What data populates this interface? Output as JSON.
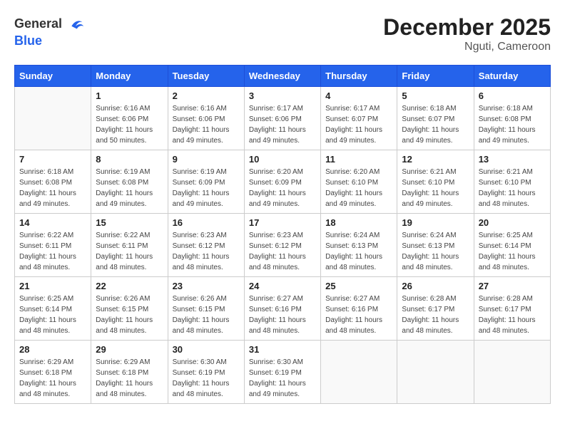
{
  "header": {
    "logo_general": "General",
    "logo_blue": "Blue",
    "month_year": "December 2025",
    "location": "Nguti, Cameroon"
  },
  "days_of_week": [
    "Sunday",
    "Monday",
    "Tuesday",
    "Wednesday",
    "Thursday",
    "Friday",
    "Saturday"
  ],
  "weeks": [
    [
      {
        "day": "",
        "info": ""
      },
      {
        "day": "1",
        "info": "Sunrise: 6:16 AM\nSunset: 6:06 PM\nDaylight: 11 hours\nand 50 minutes."
      },
      {
        "day": "2",
        "info": "Sunrise: 6:16 AM\nSunset: 6:06 PM\nDaylight: 11 hours\nand 49 minutes."
      },
      {
        "day": "3",
        "info": "Sunrise: 6:17 AM\nSunset: 6:06 PM\nDaylight: 11 hours\nand 49 minutes."
      },
      {
        "day": "4",
        "info": "Sunrise: 6:17 AM\nSunset: 6:07 PM\nDaylight: 11 hours\nand 49 minutes."
      },
      {
        "day": "5",
        "info": "Sunrise: 6:18 AM\nSunset: 6:07 PM\nDaylight: 11 hours\nand 49 minutes."
      },
      {
        "day": "6",
        "info": "Sunrise: 6:18 AM\nSunset: 6:08 PM\nDaylight: 11 hours\nand 49 minutes."
      }
    ],
    [
      {
        "day": "7",
        "info": "Sunrise: 6:18 AM\nSunset: 6:08 PM\nDaylight: 11 hours\nand 49 minutes."
      },
      {
        "day": "8",
        "info": "Sunrise: 6:19 AM\nSunset: 6:08 PM\nDaylight: 11 hours\nand 49 minutes."
      },
      {
        "day": "9",
        "info": "Sunrise: 6:19 AM\nSunset: 6:09 PM\nDaylight: 11 hours\nand 49 minutes."
      },
      {
        "day": "10",
        "info": "Sunrise: 6:20 AM\nSunset: 6:09 PM\nDaylight: 11 hours\nand 49 minutes."
      },
      {
        "day": "11",
        "info": "Sunrise: 6:20 AM\nSunset: 6:10 PM\nDaylight: 11 hours\nand 49 minutes."
      },
      {
        "day": "12",
        "info": "Sunrise: 6:21 AM\nSunset: 6:10 PM\nDaylight: 11 hours\nand 49 minutes."
      },
      {
        "day": "13",
        "info": "Sunrise: 6:21 AM\nSunset: 6:10 PM\nDaylight: 11 hours\nand 48 minutes."
      }
    ],
    [
      {
        "day": "14",
        "info": "Sunrise: 6:22 AM\nSunset: 6:11 PM\nDaylight: 11 hours\nand 48 minutes."
      },
      {
        "day": "15",
        "info": "Sunrise: 6:22 AM\nSunset: 6:11 PM\nDaylight: 11 hours\nand 48 minutes."
      },
      {
        "day": "16",
        "info": "Sunrise: 6:23 AM\nSunset: 6:12 PM\nDaylight: 11 hours\nand 48 minutes."
      },
      {
        "day": "17",
        "info": "Sunrise: 6:23 AM\nSunset: 6:12 PM\nDaylight: 11 hours\nand 48 minutes."
      },
      {
        "day": "18",
        "info": "Sunrise: 6:24 AM\nSunset: 6:13 PM\nDaylight: 11 hours\nand 48 minutes."
      },
      {
        "day": "19",
        "info": "Sunrise: 6:24 AM\nSunset: 6:13 PM\nDaylight: 11 hours\nand 48 minutes."
      },
      {
        "day": "20",
        "info": "Sunrise: 6:25 AM\nSunset: 6:14 PM\nDaylight: 11 hours\nand 48 minutes."
      }
    ],
    [
      {
        "day": "21",
        "info": "Sunrise: 6:25 AM\nSunset: 6:14 PM\nDaylight: 11 hours\nand 48 minutes."
      },
      {
        "day": "22",
        "info": "Sunrise: 6:26 AM\nSunset: 6:15 PM\nDaylight: 11 hours\nand 48 minutes."
      },
      {
        "day": "23",
        "info": "Sunrise: 6:26 AM\nSunset: 6:15 PM\nDaylight: 11 hours\nand 48 minutes."
      },
      {
        "day": "24",
        "info": "Sunrise: 6:27 AM\nSunset: 6:16 PM\nDaylight: 11 hours\nand 48 minutes."
      },
      {
        "day": "25",
        "info": "Sunrise: 6:27 AM\nSunset: 6:16 PM\nDaylight: 11 hours\nand 48 minutes."
      },
      {
        "day": "26",
        "info": "Sunrise: 6:28 AM\nSunset: 6:17 PM\nDaylight: 11 hours\nand 48 minutes."
      },
      {
        "day": "27",
        "info": "Sunrise: 6:28 AM\nSunset: 6:17 PM\nDaylight: 11 hours\nand 48 minutes."
      }
    ],
    [
      {
        "day": "28",
        "info": "Sunrise: 6:29 AM\nSunset: 6:18 PM\nDaylight: 11 hours\nand 48 minutes."
      },
      {
        "day": "29",
        "info": "Sunrise: 6:29 AM\nSunset: 6:18 PM\nDaylight: 11 hours\nand 48 minutes."
      },
      {
        "day": "30",
        "info": "Sunrise: 6:30 AM\nSunset: 6:19 PM\nDaylight: 11 hours\nand 48 minutes."
      },
      {
        "day": "31",
        "info": "Sunrise: 6:30 AM\nSunset: 6:19 PM\nDaylight: 11 hours\nand 49 minutes."
      },
      {
        "day": "",
        "info": ""
      },
      {
        "day": "",
        "info": ""
      },
      {
        "day": "",
        "info": ""
      }
    ]
  ]
}
